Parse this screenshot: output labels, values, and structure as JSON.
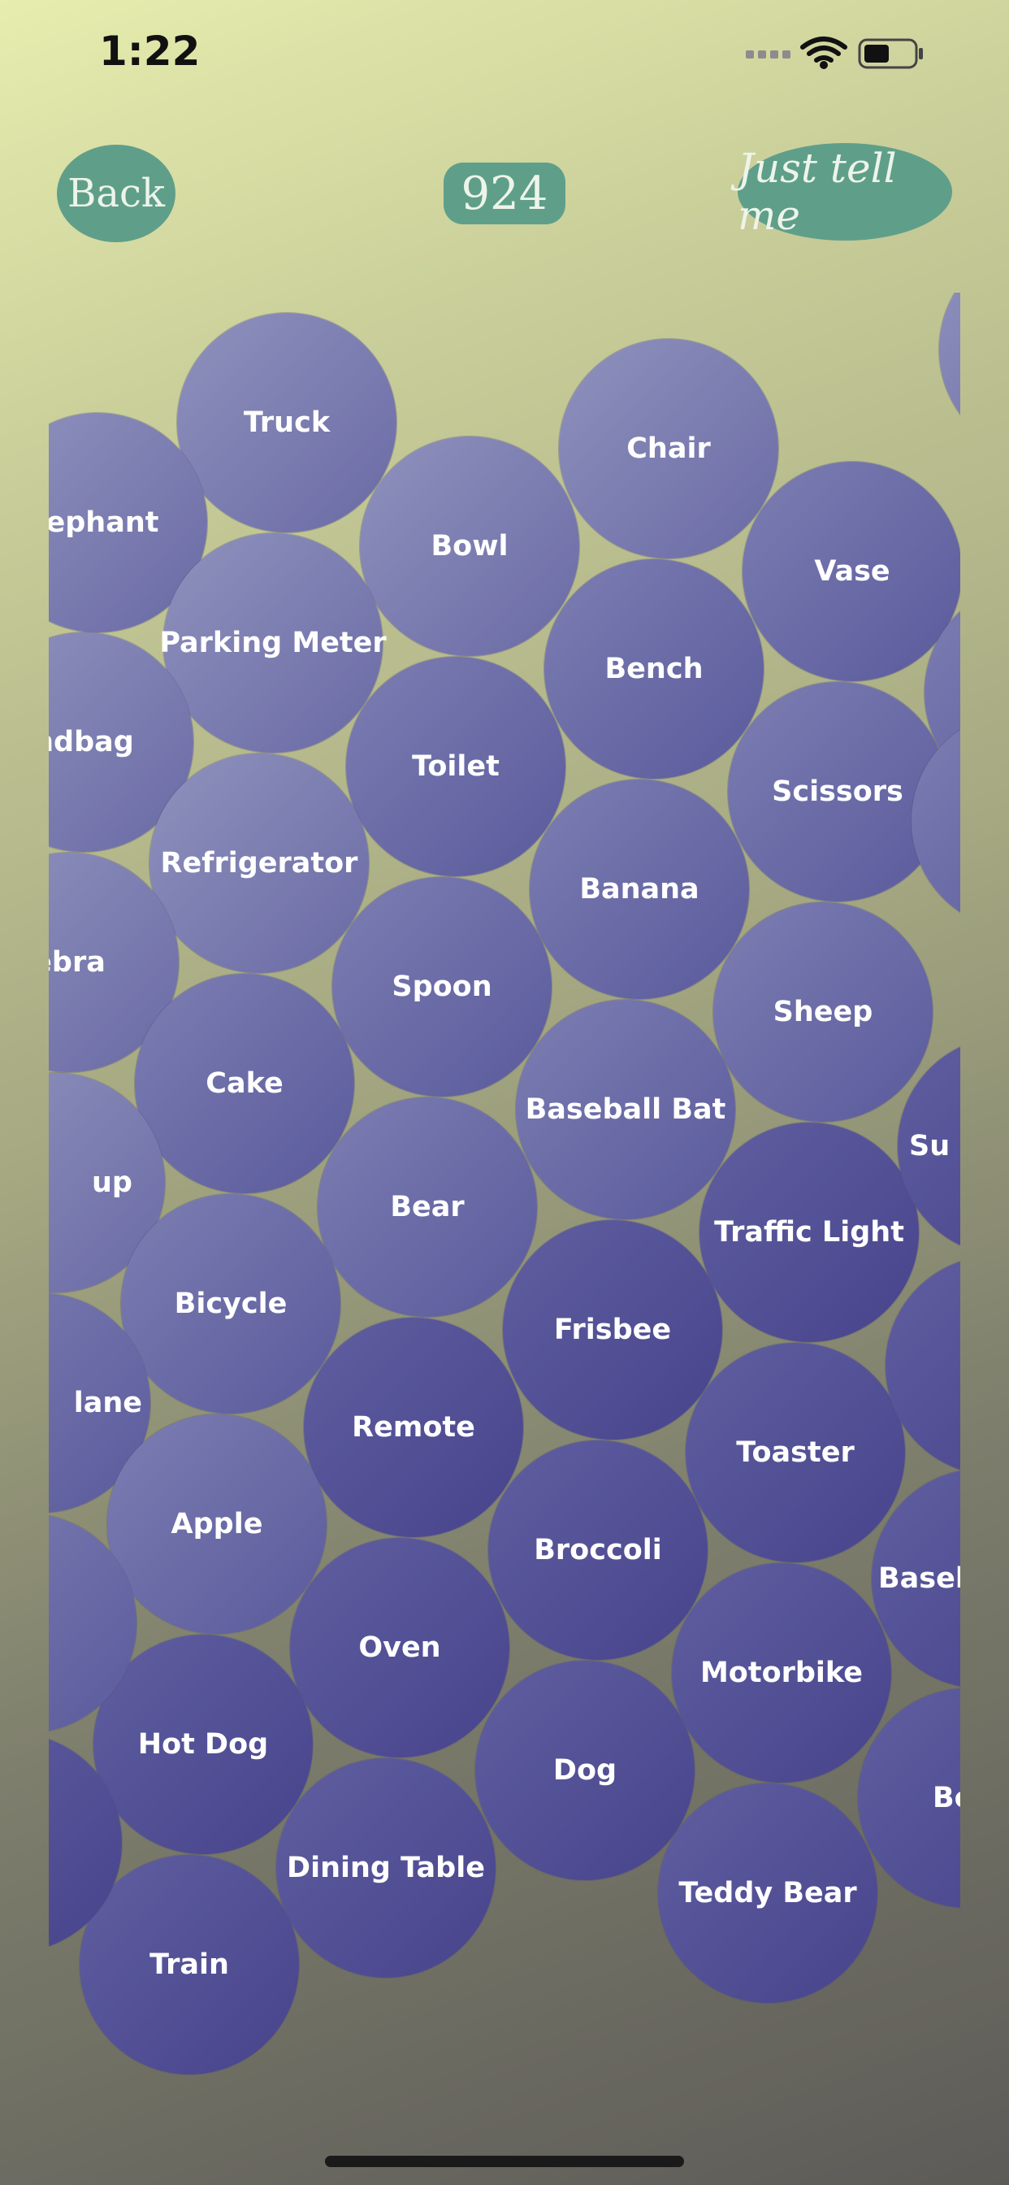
{
  "status_bar": {
    "time": "1:22"
  },
  "header": {
    "back_label": "Back",
    "count": "924",
    "tell_label": "Just tell me"
  },
  "bubbles": {
    "truck": "Truck",
    "chair": "Chair",
    "elephant": "lephant",
    "bowl": "Bowl",
    "vase": "Vase",
    "parking_meter": "Parking Meter",
    "bench": "Bench",
    "handbag": "ndbag",
    "toilet": "Toilet",
    "scissors": "Scissors",
    "refrigerator": "Refrigerator",
    "banana": "Banana",
    "zebra": "ebra",
    "spoon": "Spoon",
    "sheep": "Sheep",
    "cake": "Cake",
    "baseball_bat": "Baseball Bat",
    "cup": "up",
    "bear": "Bear",
    "traffic_light": "Traffic Light",
    "bicycle": "Bicycle",
    "frisbee": "Frisbee",
    "airplane": "lane",
    "remote": "Remote",
    "toaster": "Toaster",
    "apple": "Apple",
    "broccoli": "Broccoli",
    "baseball_glove": "Baseb",
    "oven": "Oven",
    "motorbike": "Motorbike",
    "hot_dog": "Hot Dog",
    "dog": "Dog",
    "bottle": "Bo",
    "dining_table": "Dining Table",
    "teddy_bear": "Teddy Bear",
    "train": "Train",
    "right_s": "S",
    "right_su": "Su"
  }
}
